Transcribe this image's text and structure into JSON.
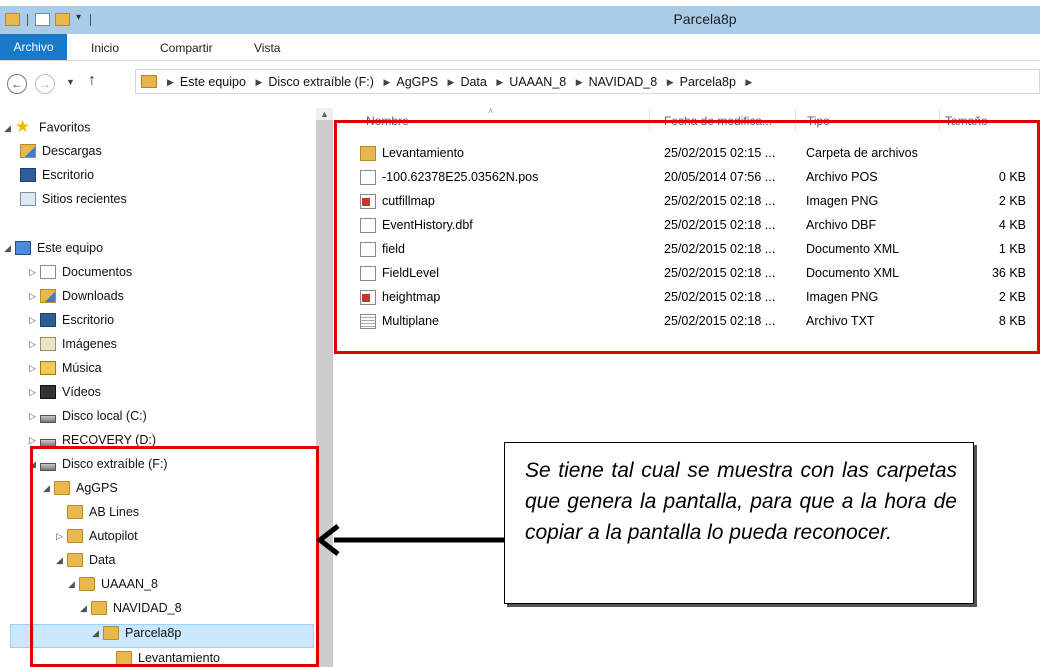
{
  "window": {
    "title": "Parcela8p"
  },
  "ribbon": {
    "tabs": [
      "Archivo",
      "Inicio",
      "Compartir",
      "Vista"
    ]
  },
  "address": {
    "crumbs": [
      "Este equipo",
      "Disco extraíble (F:)",
      "AgGPS",
      "Data",
      "UAAAN_8",
      "NAVIDAD_8",
      "Parcela8p"
    ]
  },
  "nav": {
    "items": [
      {
        "label": "Favoritos",
        "icon": "star-icon",
        "expander": "◢"
      },
      {
        "label": "Descargas",
        "icon": "downloads-folder-icon"
      },
      {
        "label": "Escritorio",
        "icon": "desktop-icon"
      },
      {
        "label": "Sitios recientes",
        "icon": "recent-places-icon"
      },
      {
        "label": "Este equipo",
        "icon": "computer-icon",
        "expander": "◢"
      },
      {
        "label": "Documentos",
        "icon": "documents-icon",
        "expander": "▷"
      },
      {
        "label": "Downloads",
        "icon": "downloads-folder-icon",
        "expander": "▷"
      },
      {
        "label": "Escritorio",
        "icon": "desktop-folder-icon",
        "expander": "▷"
      },
      {
        "label": "Imágenes",
        "icon": "pictures-icon",
        "expander": "▷"
      },
      {
        "label": "Música",
        "icon": "music-icon",
        "expander": "▷"
      },
      {
        "label": "Vídeos",
        "icon": "videos-icon",
        "expander": "▷"
      },
      {
        "label": "Disco local (C:)",
        "icon": "local-disk-icon",
        "expander": "▷"
      },
      {
        "label": "RECOVERY (D:)",
        "icon": "drive-icon",
        "expander": "▷"
      },
      {
        "label": "Disco extraíble (F:)",
        "icon": "removable-drive-icon",
        "expander": "◢"
      },
      {
        "label": "AgGPS",
        "icon": "folder-icon",
        "expander": "◢"
      },
      {
        "label": "AB Lines",
        "icon": "folder-icon"
      },
      {
        "label": "Autopilot",
        "icon": "folder-icon",
        "expander": "▷"
      },
      {
        "label": "Data",
        "icon": "folder-icon",
        "expander": "◢"
      },
      {
        "label": "UAAAN_8",
        "icon": "folder-icon",
        "expander": "◢"
      },
      {
        "label": "NAVIDAD_8",
        "icon": "folder-icon",
        "expander": "◢"
      },
      {
        "label": "Parcela8p",
        "icon": "folder-icon",
        "expander": "◢",
        "selected": true
      },
      {
        "label": "Levantamiento",
        "icon": "folder-icon"
      }
    ]
  },
  "columns": {
    "name": "Nombre",
    "date": "Fecha de modifica...",
    "type": "Tipo",
    "size": "Tamaño"
  },
  "files": [
    {
      "name": "Levantamiento",
      "date": "25/02/2015 02:15 ...",
      "type": "Carpeta de archivos",
      "size": "",
      "icon": "folder-icon"
    },
    {
      "name": "-100.62378E25.03562N.pos",
      "date": "20/05/2014 07:56 ...",
      "type": "Archivo POS",
      "size": "0 KB",
      "icon": "file-icon"
    },
    {
      "name": "cutfillmap",
      "date": "25/02/2015 02:18 ...",
      "type": "Imagen PNG",
      "size": "2 KB",
      "icon": "png-image-icon"
    },
    {
      "name": "EventHistory.dbf",
      "date": "25/02/2015 02:18 ...",
      "type": "Archivo DBF",
      "size": "4 KB",
      "icon": "file-icon"
    },
    {
      "name": "field",
      "date": "25/02/2015 02:18 ...",
      "type": "Documento XML",
      "size": "1 KB",
      "icon": "file-icon"
    },
    {
      "name": "FieldLevel",
      "date": "25/02/2015 02:18 ...",
      "type": "Documento XML",
      "size": "36 KB",
      "icon": "file-icon"
    },
    {
      "name": "heightmap",
      "date": "25/02/2015 02:18 ...",
      "type": "Imagen PNG",
      "size": "2 KB",
      "icon": "png-image-icon"
    },
    {
      "name": "Multiplane",
      "date": "25/02/2015 02:18 ...",
      "type": "Archivo TXT",
      "size": "8 KB",
      "icon": "text-file-icon"
    }
  ],
  "note": {
    "text": "Se tiene tal cual se muestra con las carpetas que genera la pantalla, para que a la hora de copiar a la pantalla lo pueda reconocer."
  },
  "colors": {
    "highlight_red": "#e00000",
    "title_bar": "#a9cde8",
    "archivo_tab": "#1979ca",
    "selection": "#cce8ff"
  }
}
